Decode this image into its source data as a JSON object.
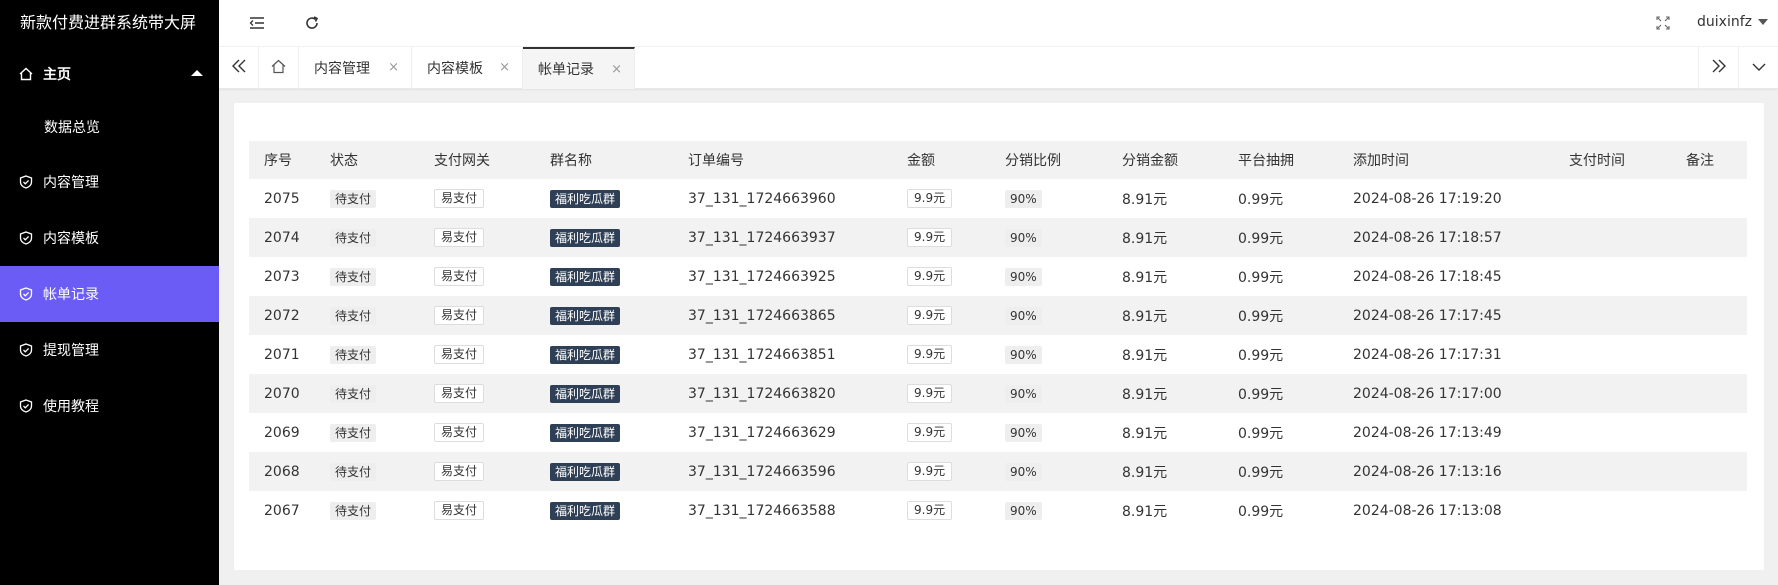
{
  "sidebar": {
    "title": "新款付费进群系统带大屏",
    "home_label": "主页",
    "home_sub": "数据总览",
    "items": [
      {
        "label": "内容管理"
      },
      {
        "label": "内容模板"
      },
      {
        "label": "帐单记录"
      },
      {
        "label": "提现管理"
      },
      {
        "label": "使用教程"
      }
    ],
    "active_color": "#6a5cf5"
  },
  "header": {
    "username": "duixinfz"
  },
  "tabs": {
    "items": [
      {
        "label": "内容管理"
      },
      {
        "label": "内容模板"
      },
      {
        "label": "帐单记录"
      }
    ],
    "close_glyph": "×"
  },
  "table": {
    "columns": [
      "序号",
      "状态",
      "支付网关",
      "群名称",
      "订单编号",
      "金额",
      "分销比例",
      "分销金额",
      "平台抽拥",
      "添加时间",
      "支付时间",
      "备注"
    ],
    "rows": [
      {
        "id": "2075",
        "status": "待支付",
        "gateway": "易支付",
        "group": "福利吃瓜群",
        "order": "37_131_1724663960",
        "amount": "9.9元",
        "ratio": "90%",
        "dist_amount": "8.91元",
        "fee": "0.99元",
        "added": "2024-08-26 17:19:20",
        "paid": "",
        "note": ""
      },
      {
        "id": "2074",
        "status": "待支付",
        "gateway": "易支付",
        "group": "福利吃瓜群",
        "order": "37_131_1724663937",
        "amount": "9.9元",
        "ratio": "90%",
        "dist_amount": "8.91元",
        "fee": "0.99元",
        "added": "2024-08-26 17:18:57",
        "paid": "",
        "note": ""
      },
      {
        "id": "2073",
        "status": "待支付",
        "gateway": "易支付",
        "group": "福利吃瓜群",
        "order": "37_131_1724663925",
        "amount": "9.9元",
        "ratio": "90%",
        "dist_amount": "8.91元",
        "fee": "0.99元",
        "added": "2024-08-26 17:18:45",
        "paid": "",
        "note": ""
      },
      {
        "id": "2072",
        "status": "待支付",
        "gateway": "易支付",
        "group": "福利吃瓜群",
        "order": "37_131_1724663865",
        "amount": "9.9元",
        "ratio": "90%",
        "dist_amount": "8.91元",
        "fee": "0.99元",
        "added": "2024-08-26 17:17:45",
        "paid": "",
        "note": ""
      },
      {
        "id": "2071",
        "status": "待支付",
        "gateway": "易支付",
        "group": "福利吃瓜群",
        "order": "37_131_1724663851",
        "amount": "9.9元",
        "ratio": "90%",
        "dist_amount": "8.91元",
        "fee": "0.99元",
        "added": "2024-08-26 17:17:31",
        "paid": "",
        "note": ""
      },
      {
        "id": "2070",
        "status": "待支付",
        "gateway": "易支付",
        "group": "福利吃瓜群",
        "order": "37_131_1724663820",
        "amount": "9.9元",
        "ratio": "90%",
        "dist_amount": "8.91元",
        "fee": "0.99元",
        "added": "2024-08-26 17:17:00",
        "paid": "",
        "note": ""
      },
      {
        "id": "2069",
        "status": "待支付",
        "gateway": "易支付",
        "group": "福利吃瓜群",
        "order": "37_131_1724663629",
        "amount": "9.9元",
        "ratio": "90%",
        "dist_amount": "8.91元",
        "fee": "0.99元",
        "added": "2024-08-26 17:13:49",
        "paid": "",
        "note": ""
      },
      {
        "id": "2068",
        "status": "待支付",
        "gateway": "易支付",
        "group": "福利吃瓜群",
        "order": "37_131_1724663596",
        "amount": "9.9元",
        "ratio": "90%",
        "dist_amount": "8.91元",
        "fee": "0.99元",
        "added": "2024-08-26 17:13:16",
        "paid": "",
        "note": ""
      },
      {
        "id": "2067",
        "status": "待支付",
        "gateway": "易支付",
        "group": "福利吃瓜群",
        "order": "37_131_1724663588",
        "amount": "9.9元",
        "ratio": "90%",
        "dist_amount": "8.91元",
        "fee": "0.99元",
        "added": "2024-08-26 17:13:08",
        "paid": "",
        "note": ""
      }
    ]
  }
}
